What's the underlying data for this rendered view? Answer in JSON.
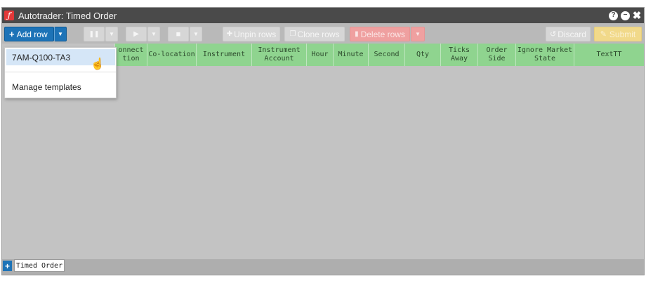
{
  "window": {
    "title": "Autotrader: Timed Order",
    "logo_glyph": "ƒ",
    "help_icon": "?",
    "minimize_icon": "−",
    "close_icon": "✖"
  },
  "toolbar": {
    "add_row_label": "Add row",
    "pause_icon": "❚❚",
    "play_icon": "▶",
    "stop_icon": "■",
    "unpin_rows_label": "Unpin rows",
    "clone_rows_label": "Clone rows",
    "delete_rows_label": "Delete rows",
    "discard_label": "Discard",
    "submit_label": "Submit"
  },
  "columns": [
    "onnect\ntion",
    "Co-location",
    "Instrument",
    "Instrument\nAccount",
    "Hour",
    "Minute",
    "Second",
    "Qty",
    "Ticks\nAway",
    "Order\nSide",
    "Ignore Market\nState",
    "TextTT"
  ],
  "dropdown": {
    "template_item": "7AM-Q100-TA3",
    "manage_templates": "Manage templates"
  },
  "tabs": {
    "add_tab_icon": "+",
    "active_tab": "Timed Order"
  },
  "colors": {
    "accent_blue": "#1d73b7",
    "header_green": "#8fd48f",
    "delete_red": "#efa0a0",
    "submit_yellow": "#f1d98a"
  }
}
